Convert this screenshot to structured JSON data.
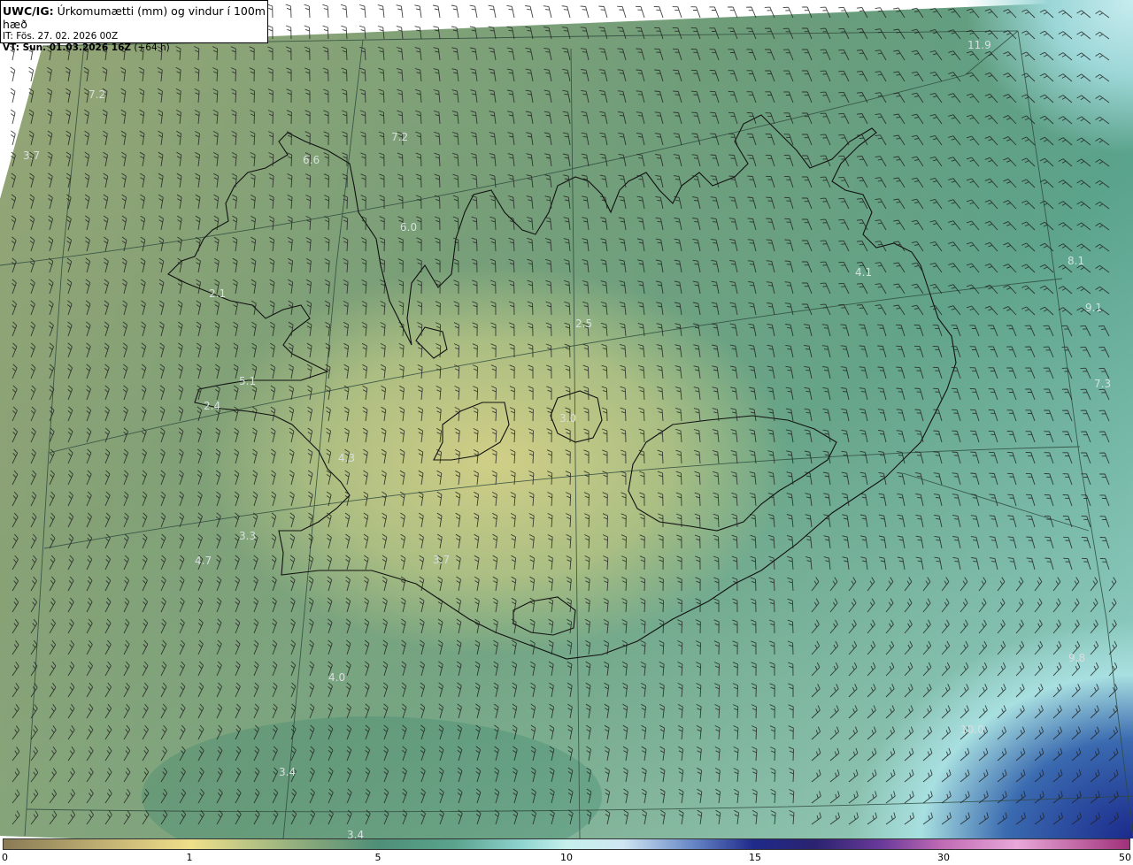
{
  "title": {
    "source": "UWC/IG:",
    "description": "Úrkomumætti (mm) og vindur í 100m hæð",
    "init_time": "IT: Fös. 27. 02. 2026 00Z",
    "valid_prefix": "VT: Sun. 01.03.2026 16Z",
    "valid_suffix": "(+64 h)"
  },
  "colors": {
    "dry": "#8a7a55",
    "low": "#f0e08a",
    "mid": "#4e8f78",
    "high": "#b8ece6",
    "heavy": "#1f2a8a",
    "extreme": "#a0307a"
  },
  "labels": [
    {
      "text": "7.2"
    },
    {
      "text": "3.7"
    },
    {
      "text": "6.6"
    },
    {
      "text": "7.2"
    },
    {
      "text": "6.0"
    },
    {
      "text": "11.9"
    },
    {
      "text": "4.1"
    },
    {
      "text": "2.1"
    },
    {
      "text": "2.5"
    },
    {
      "text": "5.1"
    },
    {
      "text": "2.4"
    },
    {
      "text": "4.3"
    },
    {
      "text": "3.3"
    },
    {
      "text": "4.7"
    },
    {
      "text": "3.7"
    },
    {
      "text": "4.0"
    },
    {
      "text": "3.4"
    },
    {
      "text": "3.4"
    },
    {
      "text": "9.8"
    },
    {
      "text": "10.0"
    },
    {
      "text": "7.3"
    },
    {
      "text": "9.1"
    },
    {
      "text": "8.1"
    },
    {
      "text": "3.0"
    }
  ],
  "colorbar": {
    "ticks": [
      "0",
      "1",
      "5",
      "10",
      "15",
      "30",
      "50"
    ],
    "icon": "colorbar-gradient"
  }
}
